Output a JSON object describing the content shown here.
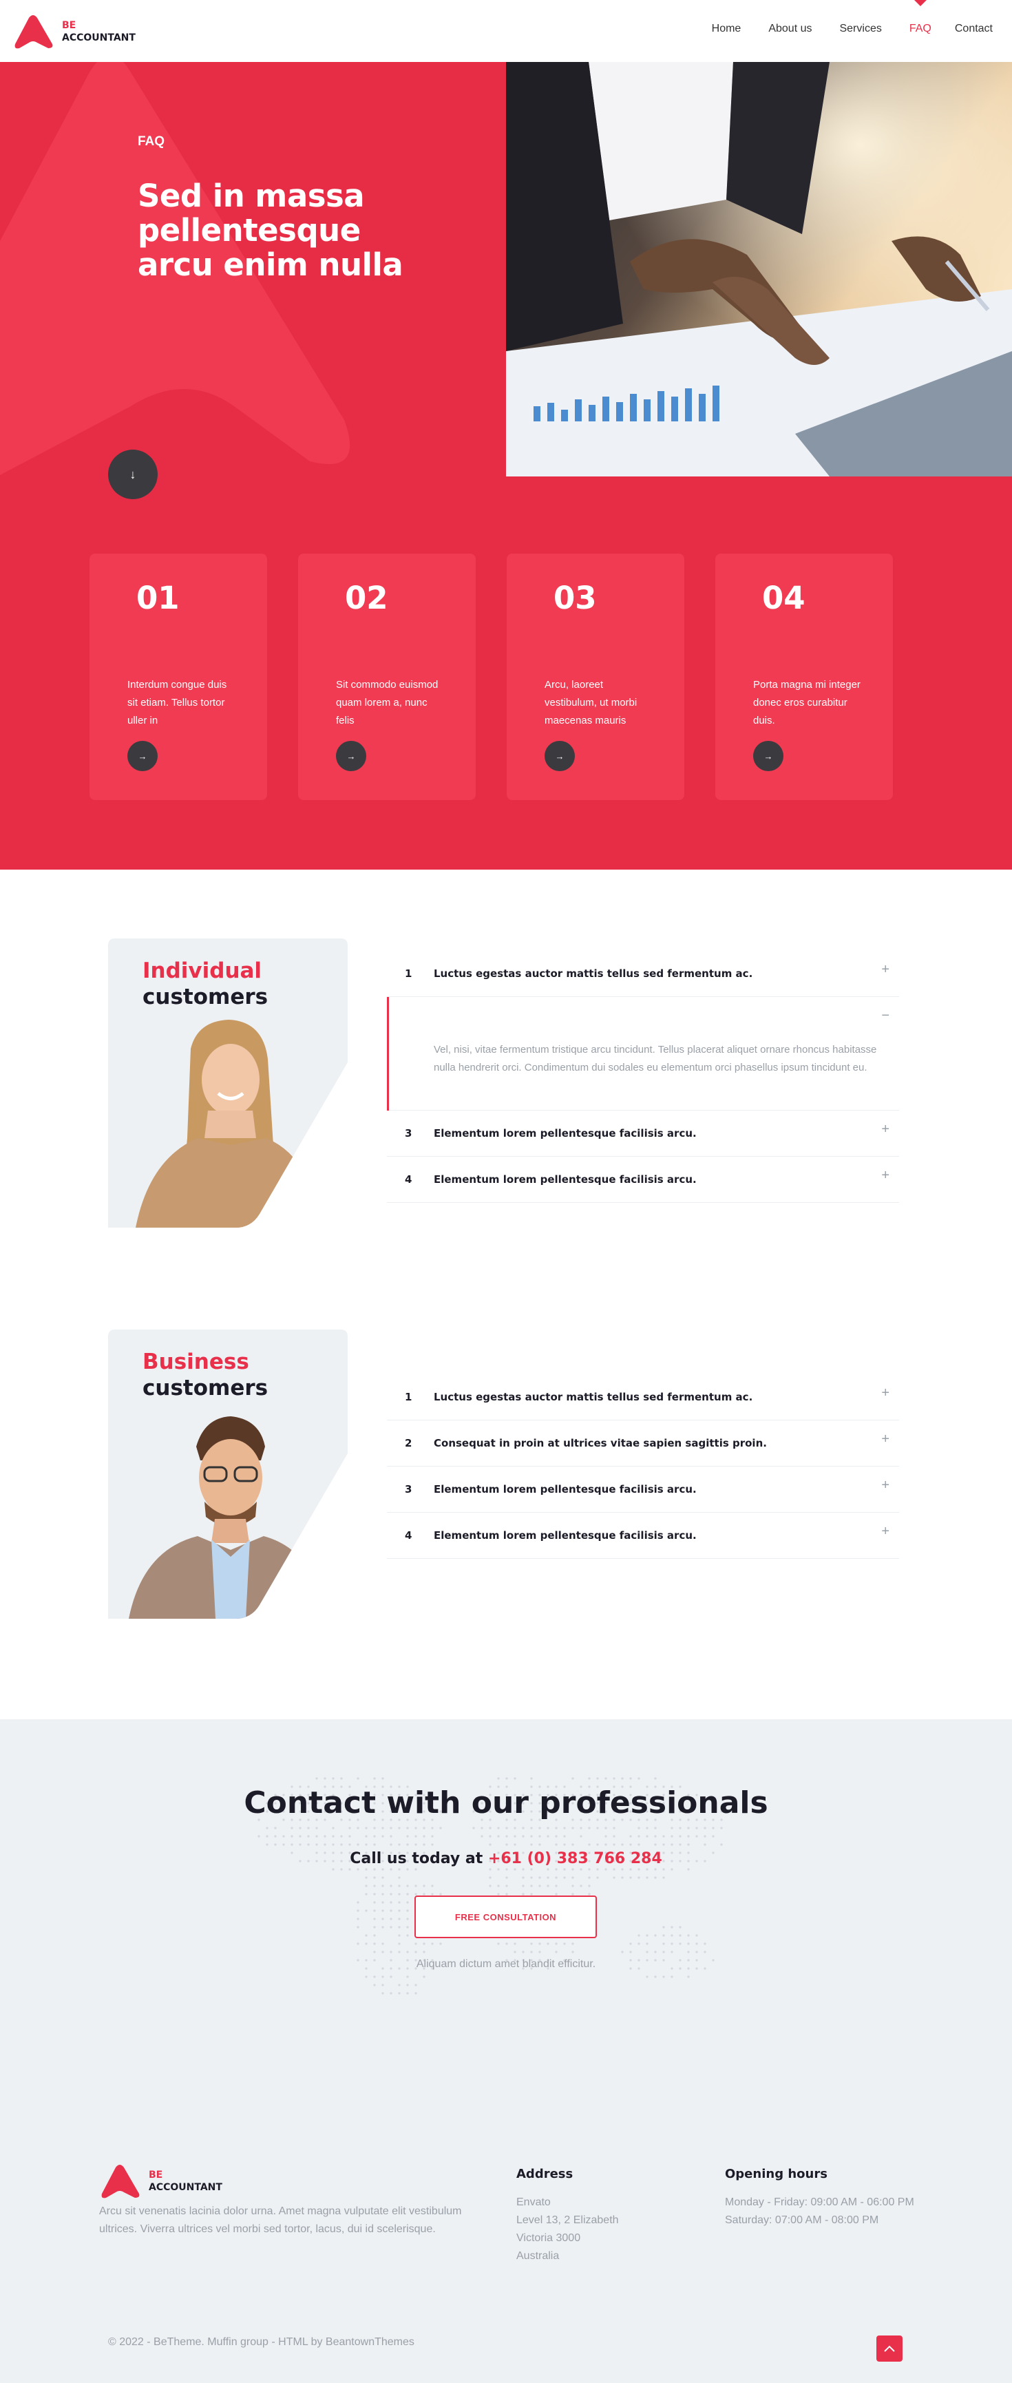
{
  "brand": {
    "line1": "BE",
    "line2": "ACCOUNTANT",
    "color": "#e8304a"
  },
  "nav": [
    {
      "label": "Home",
      "active": false
    },
    {
      "label": "About us",
      "active": false
    },
    {
      "label": "Services",
      "active": false
    },
    {
      "label": "FAQ",
      "active": true
    },
    {
      "label": "Contact",
      "active": false
    }
  ],
  "hero": {
    "label": "FAQ",
    "title": "Sed in massa pellentesque arcu enim nulla",
    "scroll_icon": "arrow-down-icon",
    "photo": "business-meeting-charts-photo"
  },
  "cards": [
    {
      "num": "01",
      "text": "Interdum congue duis sit etiam. Tellus tortor uller in",
      "icon": "arrow-right-icon"
    },
    {
      "num": "02",
      "text": "Sit commodo euismod quam lorem a, nunc felis",
      "icon": "arrow-right-icon"
    },
    {
      "num": "03",
      "text": "Arcu, laoreet vestibulum, ut morbi maecenas mauris",
      "icon": "arrow-right-icon"
    },
    {
      "num": "04",
      "text": "Porta magna mi integer donec eros curabitur duis.",
      "icon": "arrow-right-icon"
    }
  ],
  "individual": {
    "title_red": "Individual",
    "title_dark": "customers",
    "items": [
      {
        "num": "1",
        "q": "Luctus egestas auctor mattis tellus sed fermentum ac.",
        "toggle": "+"
      },
      {
        "num": "",
        "q": "",
        "toggle": "−",
        "answer": "Vel, nisi, vitae fermentum tristique arcu tincidunt. Tellus placerat aliquet ornare rhoncus habitasse nulla hendrerit orci. Condimentum dui sodales eu elementum orci phasellus ipsum tincidunt eu."
      },
      {
        "num": "3",
        "q": "Elementum lorem pellentesque facilisis arcu.",
        "toggle": "+"
      },
      {
        "num": "4",
        "q": "Elementum lorem pellentesque facilisis arcu.",
        "toggle": "+"
      }
    ]
  },
  "business": {
    "title_red": "Business",
    "title_dark": "customers",
    "items": [
      {
        "num": "1",
        "q": "Luctus egestas auctor mattis tellus sed fermentum ac.",
        "toggle": "+"
      },
      {
        "num": "2",
        "q": "Consequat in proin at ultrices vitae sapien sagittis proin.",
        "toggle": "+"
      },
      {
        "num": "3",
        "q": "Elementum lorem pellentesque facilisis arcu.",
        "toggle": "+"
      },
      {
        "num": "4",
        "q": "Elementum lorem pellentesque facilisis arcu.",
        "toggle": "+"
      }
    ]
  },
  "contact": {
    "title": "Contact with our professionals",
    "call_prefix": "Call us today at ",
    "phone": "+61 (0) 383 766 284",
    "button": "FREE CONSULTATION",
    "sub": "Aliquam dictum amet blandit efficitur."
  },
  "footer": {
    "description": "Arcu sit venenatis lacinia dolor urna. Amet magna vulputate elit vestibulum ultrices. Viverra ultrices vel morbi sed tortor, lacus, dui id scelerisque.",
    "address_title": "Address",
    "address_lines": [
      "Envato",
      "Level 13, 2 Elizabeth",
      "Victoria 3000",
      "Australia"
    ],
    "hours_title": "Opening hours",
    "hours_lines": [
      "Monday - Friday: 09:00 AM - 06:00 PM",
      "Saturday: 07:00 AM - 08:00 PM"
    ],
    "copyright": "© 2022 - BeTheme. Muffin group - HTML by BeantownThemes",
    "totop_icon": "chevron-up-icon"
  }
}
